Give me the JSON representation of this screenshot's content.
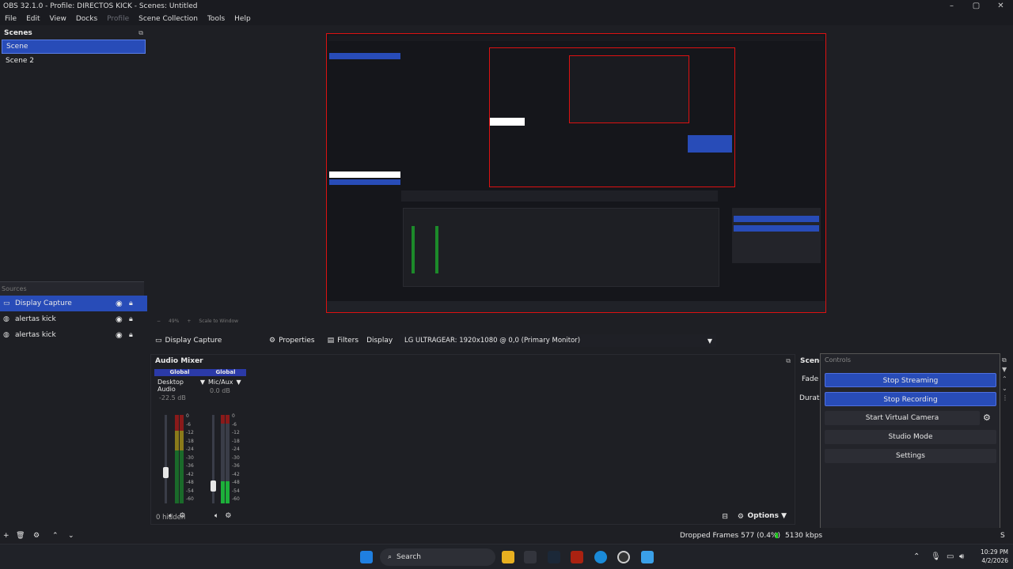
{
  "window": {
    "title": "OBS 32.1.0 - Profile: DIRECTOS KICK - Scenes: Untitled",
    "minimize": "–",
    "maximize": "▢",
    "close": "✕"
  },
  "menu": [
    "File",
    "Edit",
    "View",
    "Docks",
    "Profile",
    "Scene Collection",
    "Tools",
    "Help"
  ],
  "scenes": {
    "header": "Scenes",
    "items": [
      "Scene",
      "Scene 2"
    ]
  },
  "sources": {
    "header": "Sources",
    "items": [
      "Display Capture",
      "alertas kick",
      "alertas kick"
    ]
  },
  "zoom": {
    "level": "49%",
    "mode": "Scale to Window"
  },
  "context": {
    "source": "Display Capture",
    "properties": "Properties",
    "filters": "Filters",
    "display_label": "Display",
    "display_value": "LG ULTRAGEAR: 1920x1080 @ 0,0 (Primary Monitor)"
  },
  "mixer": {
    "header": "Audio Mixer",
    "channels": [
      {
        "global": "Global",
        "name": "Desktop Audio",
        "db": "-22.5 dB",
        "level": 0.35
      },
      {
        "global": "Global",
        "name": "Mic/Aux",
        "db": "0.0 dB",
        "level": 0.2
      }
    ],
    "ticks": [
      "0",
      "-6",
      "-12",
      "-18",
      "-24",
      "-30",
      "-36",
      "-42",
      "-48",
      "-54",
      "-60"
    ],
    "hidden": "0 hidden",
    "options": "Options"
  },
  "transitions": {
    "header": "Scene",
    "fade": "Fade",
    "duration": "Durati"
  },
  "controls": {
    "header": "Controls",
    "buttons": [
      "Stop Streaming",
      "Stop Recording",
      "Start Virtual Camera",
      "Studio Mode",
      "Settings"
    ]
  },
  "status": {
    "dropped": "Dropped Frames 577 (0.4%)",
    "bitrate": "5130 kbps",
    "extra": "S"
  },
  "taskbar": {
    "search": "Search",
    "time": "10:29 PM",
    "date": "4/2/2026"
  },
  "colors": {
    "accent": "#284cb8",
    "bg": "#1e1f24",
    "recording_border": "#dd1111"
  }
}
